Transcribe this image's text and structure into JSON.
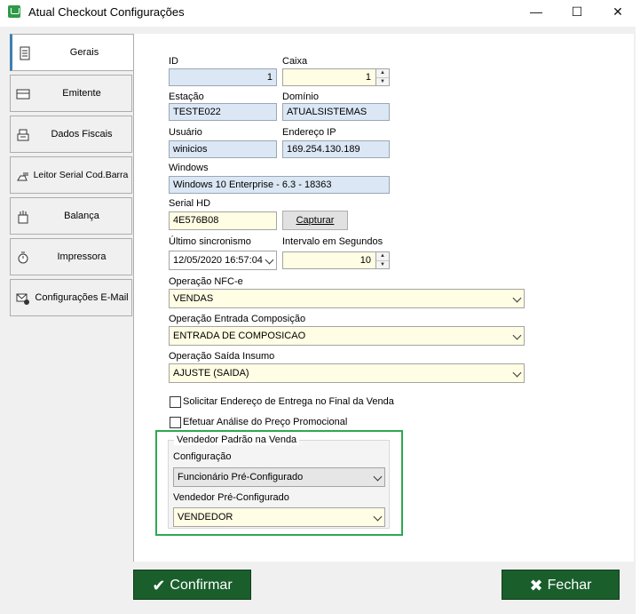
{
  "window": {
    "title": "Atual Checkout Configurações",
    "minimize_glyph": "—",
    "maximize_glyph": "☐",
    "close_glyph": "✕"
  },
  "tabs": [
    {
      "label": "Gerais",
      "icon": "document-icon",
      "active": true
    },
    {
      "label": "Emitente",
      "icon": "card-icon",
      "active": false
    },
    {
      "label": "Dados Fiscais",
      "icon": "register-icon",
      "active": false
    },
    {
      "label": "Leitor Serial Cod.Barra",
      "icon": "barcode-scanner-icon",
      "active": false
    },
    {
      "label": "Balança",
      "icon": "scale-icon",
      "active": false
    },
    {
      "label": "Impressora",
      "icon": "printer-icon",
      "active": false
    },
    {
      "label": "Configurações E-Mail",
      "icon": "email-settings-icon",
      "active": false
    }
  ],
  "form": {
    "id": {
      "label": "ID",
      "value": "1"
    },
    "caixa": {
      "label": "Caixa",
      "value": "1"
    },
    "estacao": {
      "label": "Estação",
      "value": "TESTE022"
    },
    "dominio": {
      "label": "Domínio",
      "value": "ATUALSISTEMAS"
    },
    "usuario": {
      "label": "Usuário",
      "value": "winicios"
    },
    "endereco_ip": {
      "label": "Endereço IP",
      "value": "169.254.130.189"
    },
    "windows": {
      "label": "Windows",
      "value": "Windows 10 Enterprise - 6.3 - 18363"
    },
    "serial_hd": {
      "label": "Serial HD",
      "value": "4E576B08"
    },
    "capturar_button": "Capturar",
    "ultimo_sincronismo": {
      "label": "Último sincronismo",
      "value": "12/05/2020 16:57:04"
    },
    "intervalo": {
      "label": "Intervalo em Segundos",
      "value": "10"
    },
    "operacao_nfce": {
      "label": "Operação NFC-e",
      "value": "VENDAS"
    },
    "operacao_entrada": {
      "label": "Operação Entrada Composição",
      "value": "ENTRADA DE COMPOSICAO"
    },
    "operacao_saida": {
      "label": "Operação Saída Insumo",
      "value": "AJUSTE (SAIDA)"
    },
    "chk_endereco": {
      "label": "Solicitar Endereço de Entrega no Final da Venda",
      "checked": false
    },
    "chk_preco": {
      "label": "Efetuar Análise do Preço Promocional",
      "checked": false
    },
    "vendedor_group": {
      "title": "Vendedor Padrão na Venda",
      "configuracao": {
        "label": "Configuração",
        "value": "Funcionário Pré-Configurado"
      },
      "vendedor": {
        "label": "Vendedor Pré-Configurado",
        "value": "VENDEDOR"
      }
    }
  },
  "footer": {
    "confirmar": "Confirmar",
    "fechar": "Fechar",
    "confirmar_icon": "check-icon",
    "fechar_icon": "x-icon"
  },
  "colors": {
    "button_green": "#1a5e2c",
    "highlight_green": "#2fa84f",
    "field_blue": "#dbe7f4",
    "field_yellow": "#fffde3"
  }
}
